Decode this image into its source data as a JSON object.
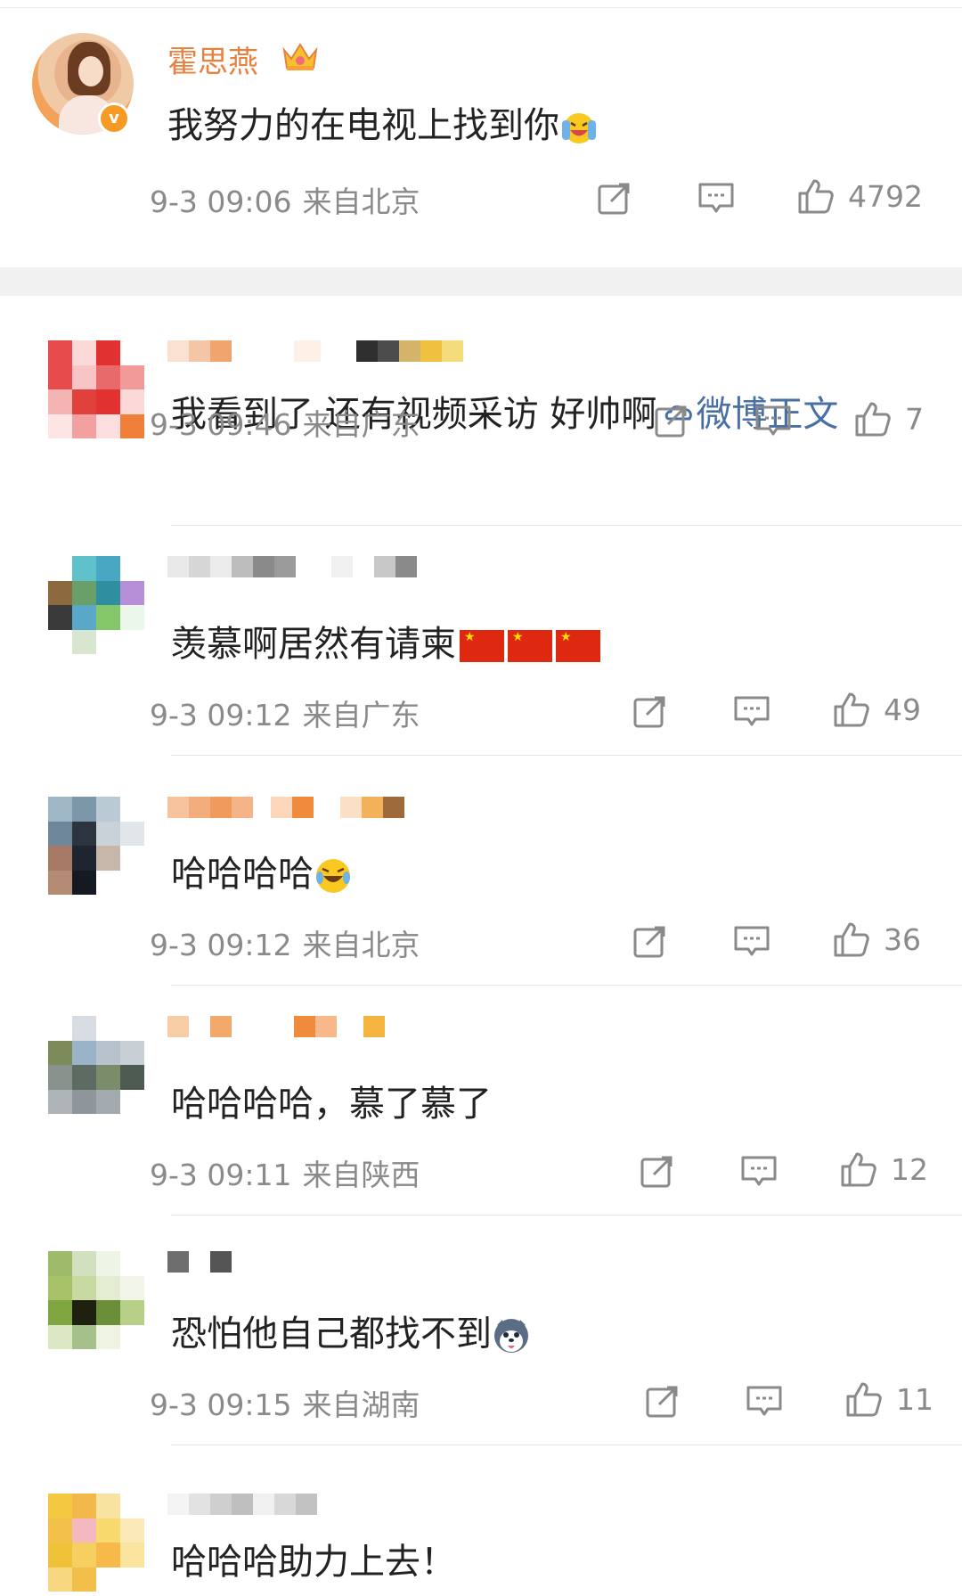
{
  "post": {
    "author": "霍思燕",
    "text": "我努力的在电视上找到你",
    "time": "9-3 09:06",
    "location": "来自北京",
    "likes": "4792"
  },
  "comments": [
    {
      "text": "我看到了 还有视频采访 好帅啊",
      "link": "微博正文",
      "time": "9-3 09:46",
      "location": "来自广东",
      "likes": "7"
    },
    {
      "text": "羡慕啊居然有请柬",
      "time": "9-3 09:12",
      "location": "来自广东",
      "likes": "49"
    },
    {
      "text": "哈哈哈哈",
      "time": "9-3 09:12",
      "location": "来自北京",
      "likes": "36"
    },
    {
      "text": "哈哈哈哈，慕了慕了",
      "time": "9-3 09:11",
      "location": "来自陕西",
      "likes": "12"
    },
    {
      "text": "恐怕他自己都找不到",
      "time": "9-3 09:15",
      "location": "来自湖南",
      "likes": "11"
    },
    {
      "text": "哈哈哈助力上去！"
    }
  ],
  "icons": {
    "share": "share-icon",
    "comment": "comment-icon",
    "like": "thumbs-up-icon"
  },
  "colors": {
    "author_name": "#e8813f",
    "verified_badge": "#f59b24",
    "link": "#4a6fa5",
    "meta_text": "#8a8a8a"
  }
}
